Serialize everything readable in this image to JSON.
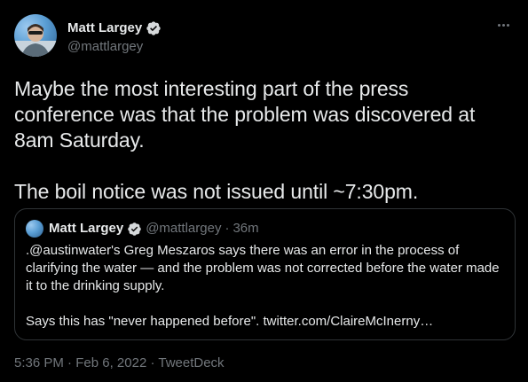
{
  "author": {
    "display_name": "Matt Largey",
    "handle": "@mattlargey",
    "verified": true
  },
  "tweet": {
    "paragraphs": [
      "Maybe the most interesting part of the press conference was that the problem was discovered at 8am Saturday.",
      "The boil notice was not issued until ~7:30pm."
    ]
  },
  "quoted_tweet": {
    "display_name": "Matt Largey",
    "handle": "@mattlargey",
    "separator": "·",
    "time": "36m",
    "paragraphs": [
      ".@austinwater's Greg Meszaros says there was an error in the process of clarifying the water — and the problem was not corrected before the water made it to the drinking supply.",
      "Says this has \"never happened before\". twitter.com/ClaireMcInerny…"
    ]
  },
  "footer": {
    "time": "5:36 PM",
    "separator1": "·",
    "date": "Feb 6, 2022",
    "separator2": "·",
    "source": "TweetDeck"
  },
  "colors": {
    "background": "#000000",
    "text": "#e7e9ea",
    "secondary": "#71767b",
    "border": "#2f3336",
    "verified": "#d6d9db"
  },
  "icons": {
    "verified": "verified-badge-icon",
    "more": "more-options-icon"
  }
}
